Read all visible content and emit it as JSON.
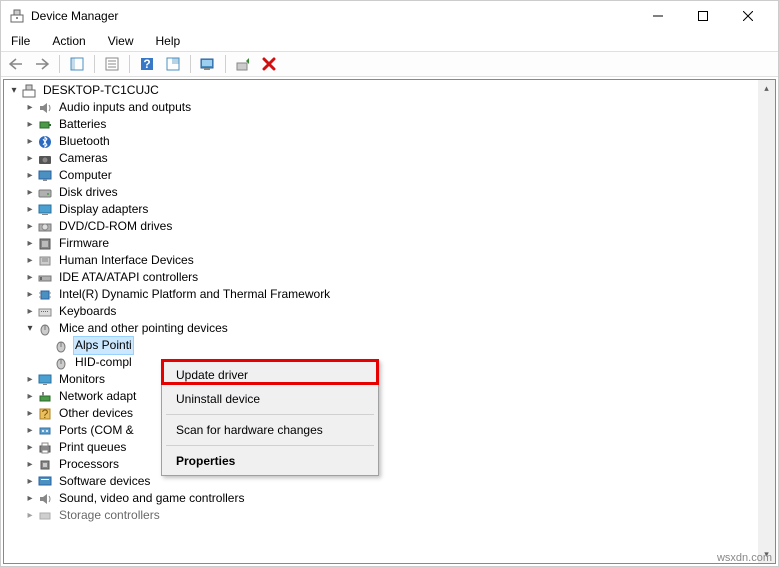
{
  "window": {
    "title": "Device Manager"
  },
  "menu": {
    "file": "File",
    "action": "Action",
    "view": "View",
    "help": "Help"
  },
  "tree": {
    "root": "DESKTOP-TC1CUJC",
    "audio": "Audio inputs and outputs",
    "batteries": "Batteries",
    "bluetooth": "Bluetooth",
    "cameras": "Cameras",
    "computer": "Computer",
    "disk": "Disk drives",
    "display": "Display adapters",
    "dvd": "DVD/CD-ROM drives",
    "firmware": "Firmware",
    "hid": "Human Interface Devices",
    "ide": "IDE ATA/ATAPI controllers",
    "intel": "Intel(R) Dynamic Platform and Thermal Framework",
    "keyboards": "Keyboards",
    "mice": "Mice and other pointing devices",
    "alps": "Alps Pointi",
    "hidm": "HID-compl",
    "monitors": "Monitors",
    "network": "Network adapt",
    "other": "Other devices",
    "ports": "Ports (COM &",
    "print": "Print queues",
    "processors": "Processors",
    "software": "Software devices",
    "sound": "Sound, video and game controllers",
    "storage": "Storage controllers"
  },
  "context": {
    "update": "Update driver",
    "uninstall": "Uninstall device",
    "scan": "Scan for hardware changes",
    "properties": "Properties"
  },
  "watermark": "wsxdn.com"
}
